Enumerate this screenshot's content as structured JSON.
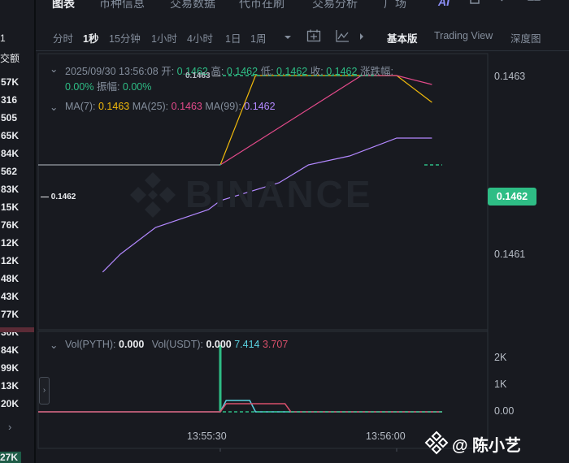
{
  "left_strip": {
    "header": "1",
    "subheader": "交额",
    "items": [
      "57K",
      "316",
      "505",
      "65K",
      "84K",
      "562",
      "83K",
      "15K",
      "76K",
      "12K",
      "12K",
      "48K",
      "43K",
      "77K",
      "30K",
      "84K",
      "99K",
      "13K",
      "20K"
    ],
    "bottom": "27K"
  },
  "tabs": [
    {
      "label": "图表",
      "active": true
    },
    {
      "label": "币种信息",
      "active": false
    },
    {
      "label": "交易数据",
      "active": false
    },
    {
      "label": "代币在刷",
      "active": false
    },
    {
      "label": "交易分析",
      "active": false
    },
    {
      "label": "广场",
      "active": false
    }
  ],
  "ai_label": "AI",
  "toolbar": {
    "intervals": [
      "分时",
      "1秒",
      "15分钟",
      "1小时",
      "4小时",
      "1日",
      "1周"
    ],
    "active_interval": "1秒",
    "views": [
      "基本版",
      "Trading View",
      "深度图"
    ],
    "active_view": "基本版"
  },
  "ohlc": {
    "datetime": "2025/09/30 13:56:08",
    "open_label": "开:",
    "open": "0.1462",
    "high_label": "高:",
    "high": "0.1462",
    "low_label": "低:",
    "low": "0.1462",
    "close_label": "收:",
    "close": "0.1462",
    "change_label": "涨跌幅:",
    "change": "0.00%",
    "amplitude_label": "振幅:",
    "amplitude": "0.00%"
  },
  "ma": {
    "ma7_label": "MA(7):",
    "ma7": "0.1463",
    "ma25_label": "MA(25):",
    "ma25": "0.1463",
    "ma99_label": "MA(99):",
    "ma99": "0.1462"
  },
  "volume_legend": {
    "pyth_label": "Vol(PYTH):",
    "pyth": "0.000",
    "usdt_label": "Vol(USDT):",
    "usdt": "0.000",
    "v1": "7.414",
    "v2": "3.707"
  },
  "watermark": "BINANCE",
  "price_axis": [
    "0.1463",
    "0.1462",
    "0.1461"
  ],
  "current_price": "0.1462",
  "hi_marker": "0.1463",
  "lo_marker": "0.1462",
  "volume_axis": [
    "2K",
    "1K",
    "0.00"
  ],
  "time_axis": [
    "13:55:30",
    "13:56:00"
  ],
  "credit": "@ 陈小艺",
  "colors": {
    "up": "#2ebd85",
    "down": "#f6465d",
    "ma7": "#f0b90b",
    "ma25": "#e34a8a",
    "ma99": "#b388ff",
    "vol_line_cyan": "#5ad1e0",
    "vol_line_red": "#d74f6a"
  },
  "chart_data": {
    "type": "line",
    "price_series": [
      {
        "name": "MA(7)",
        "points": [
          [
            "13:55:30",
            0.1462
          ],
          [
            "13:55:36",
            0.1463
          ],
          [
            "13:56:00",
            0.1463
          ],
          [
            "13:56:06",
            0.14627
          ]
        ]
      },
      {
        "name": "MA(25)",
        "points": [
          [
            "13:55:30",
            0.1462
          ],
          [
            "13:55:54",
            0.1463
          ],
          [
            "13:56:00",
            0.1463
          ],
          [
            "13:56:06",
            0.14629
          ]
        ]
      },
      {
        "name": "MA(99)",
        "points": [
          [
            "13:55:10",
            0.14608
          ],
          [
            "13:55:13",
            0.1461
          ],
          [
            "13:55:19",
            0.14613
          ],
          [
            "13:55:28",
            0.14615
          ],
          [
            "13:55:30",
            0.14616
          ],
          [
            "13:55:40",
            0.14618
          ],
          [
            "13:55:45",
            0.1462
          ],
          [
            "13:55:52",
            0.14621
          ],
          [
            "13:56:00",
            0.14623
          ],
          [
            "13:56:06",
            0.14623
          ]
        ]
      }
    ],
    "price_ylim": [
      0.14607,
      0.14631
    ],
    "volume_series": [
      {
        "name": "Vol(PYTH)",
        "points": [
          [
            "13:55:30",
            0.0
          ],
          [
            "13:55:31",
            7.414
          ],
          [
            "13:55:35",
            7.414
          ],
          [
            "13:55:36",
            0.0
          ]
        ]
      },
      {
        "name": "Vol(USDT)",
        "points": [
          [
            "13:55:30",
            0.0
          ],
          [
            "13:55:31",
            3.707
          ],
          [
            "13:55:41",
            3.707
          ],
          [
            "13:55:42",
            0.0
          ]
        ]
      }
    ],
    "volume_bars": [
      [
        "13:55:30",
        2800
      ]
    ],
    "volume_ylim": [
      0,
      2800
    ],
    "x_ticks": [
      "13:55:30",
      "13:56:00"
    ]
  }
}
